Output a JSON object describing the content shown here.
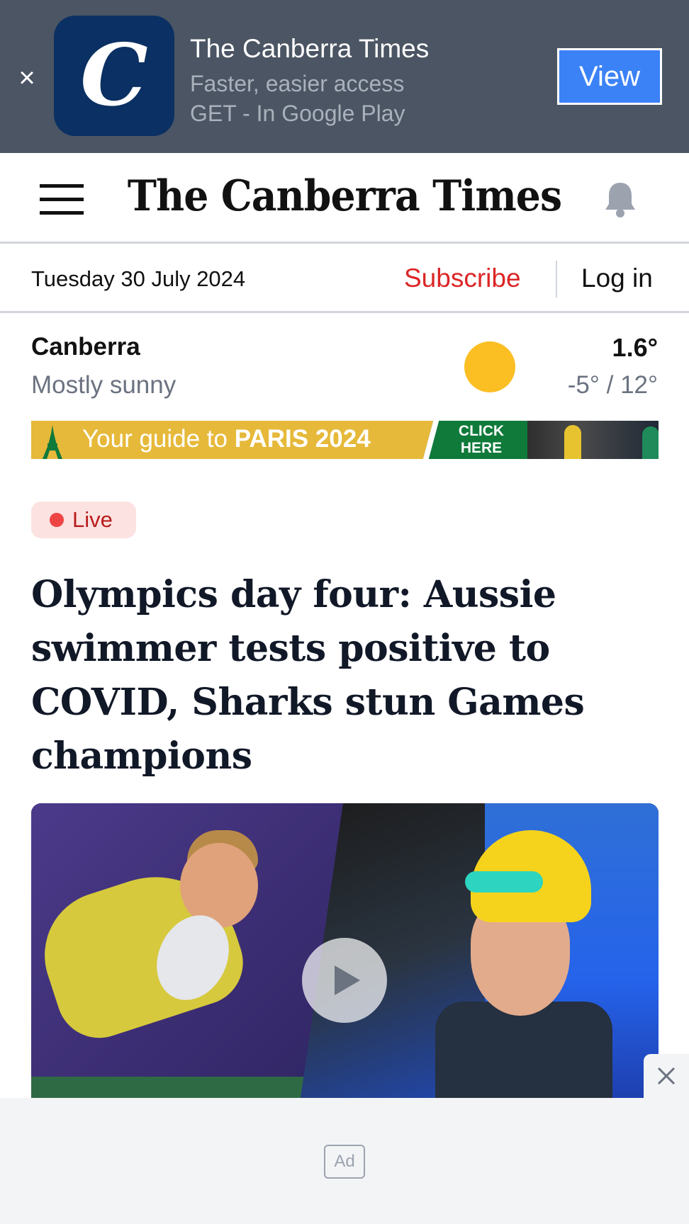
{
  "app_banner": {
    "close_glyph": "×",
    "app_name": "The Canberra Times",
    "tagline": "Faster, easier access",
    "store_text": "GET - In Google Play",
    "view_label": "View",
    "icon_letter": "C"
  },
  "masthead": {
    "logo_text": "The Canberra Times",
    "menu_icon": "hamburger-menu-icon",
    "bell_icon": "bell-icon"
  },
  "date_bar": {
    "date": "Tuesday 30 July 2024",
    "subscribe_label": "Subscribe",
    "login_label": "Log in"
  },
  "weather": {
    "city": "Canberra",
    "condition": "Mostly sunny",
    "current_temp": "1.6°",
    "range": "-5° / 12°",
    "icon": "sun-icon"
  },
  "paris_banner": {
    "text_prefix": "Your guide to ",
    "text_bold": "PARIS 2024",
    "click_line1": "CLICK",
    "click_line2": "HERE"
  },
  "article": {
    "live_label": "Live",
    "headline": "Olympics day four: Aussie swimmer tests positive to COVID, Sharks stun Games champions"
  },
  "ad": {
    "label": "Ad",
    "close_glyph": "×"
  },
  "colors": {
    "banner_bg": "#4b5563",
    "view_button": "#3b82f6",
    "subscribe": "#dc2626",
    "live_badge_bg": "#fde2e2",
    "live_dot": "#ef4444",
    "sun": "#fbbf24",
    "paris_yellow": "#e6b93a",
    "paris_green": "#0f7a3a"
  }
}
